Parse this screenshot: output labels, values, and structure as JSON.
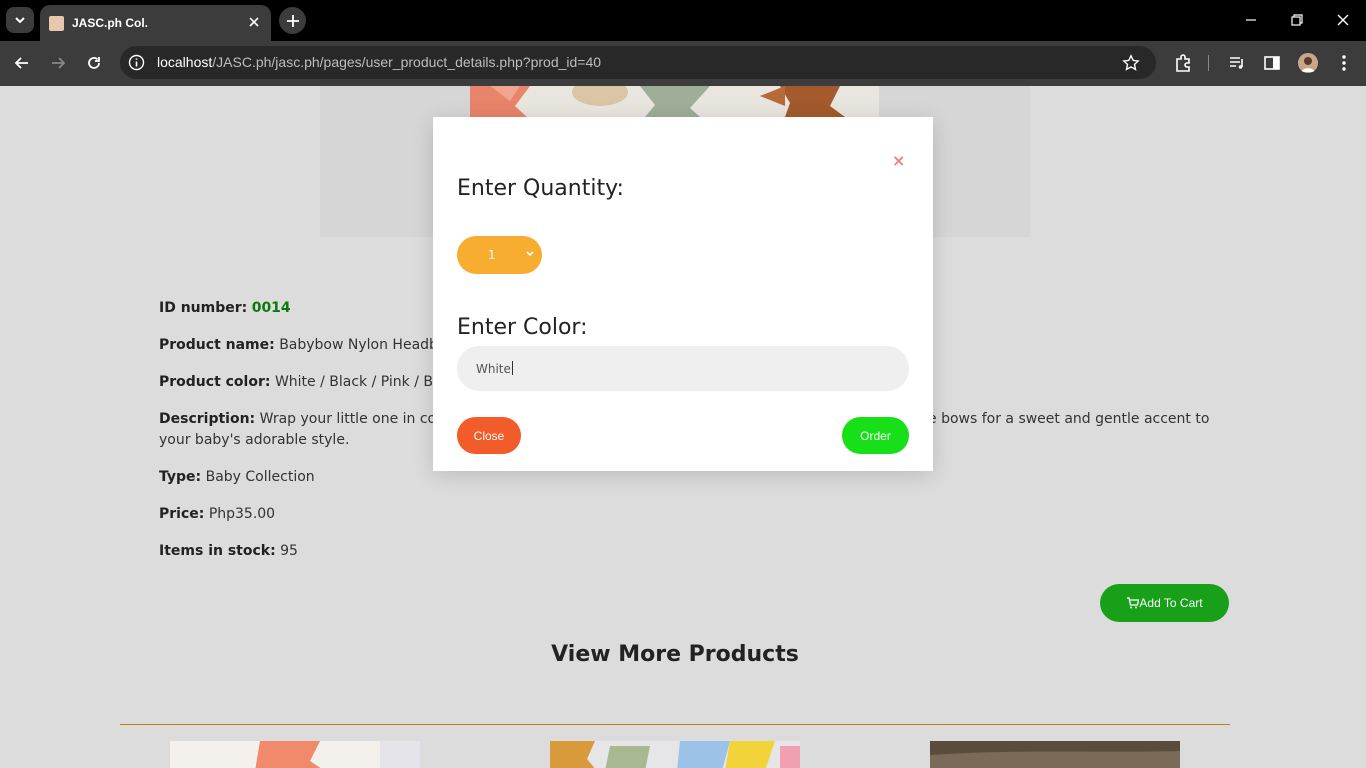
{
  "browser": {
    "tab_title": "JASC.ph Col.",
    "url_host": "localhost",
    "url_path": "/JASC.ph/jasc.ph/pages/user_product_details.php?prod_id=40"
  },
  "product": {
    "id_label": "ID number:",
    "id_value": "0014",
    "name_label": "Product name:",
    "name_value": "Babybow Nylon Headb",
    "color_label": "Product color:",
    "color_value": "White / Black / Pink / Br",
    "desc_label": "Description:",
    "desc_value_left": "Wrap your little one in cor",
    "desc_value_right": "e bows for a sweet and gentle accent to",
    "desc_value_line2": "your baby's adorable style.",
    "type_label": "Type:",
    "type_value": "Baby Collection",
    "price_label": "Price:",
    "price_value": "Php35.00",
    "stock_label": "Items in stock:",
    "stock_value": "95",
    "add_to_cart": "Add To Cart"
  },
  "more": {
    "title": "View More Products"
  },
  "modal": {
    "close_x": "×",
    "qty_label": "Enter Quantity:",
    "qty_value": "1",
    "color_label": "Enter Color:",
    "color_value": "White",
    "close_button": "Close",
    "order_button": "Order"
  },
  "colors": {
    "accent_orange": "#f7ad2f",
    "close_red": "#f25c2a",
    "order_green": "#18e018",
    "cart_green": "#18a018",
    "id_green": "#0a7a0a"
  }
}
